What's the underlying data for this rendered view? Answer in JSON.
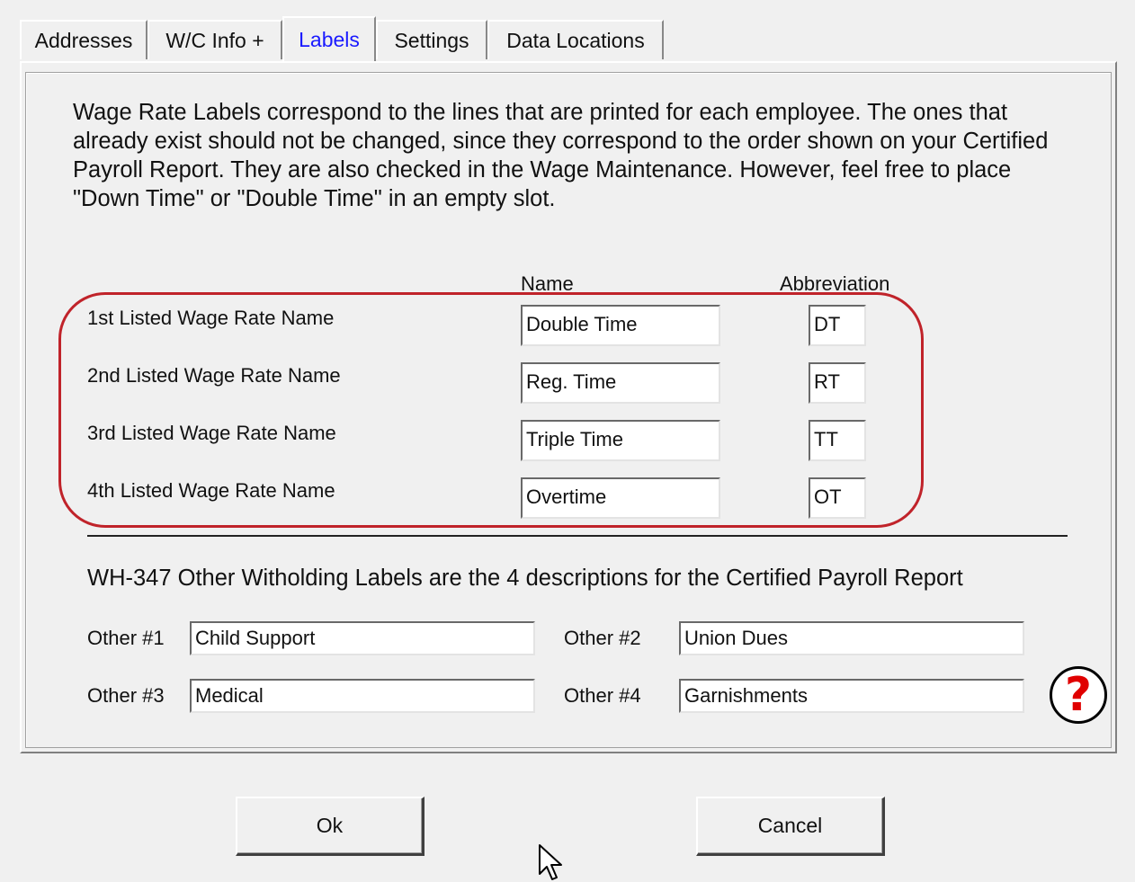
{
  "tabs": [
    {
      "label": "Addresses",
      "active": false
    },
    {
      "label": "W/C Info +",
      "active": false
    },
    {
      "label": "Labels",
      "active": true
    },
    {
      "label": "Settings",
      "active": false
    },
    {
      "label": "Data Locations",
      "active": false
    }
  ],
  "intro_text": "Wage Rate Labels correspond to the lines that are printed for each employee.  The ones that already exist should not be changed, since they correspond to the order shown on your Certified Payroll Report.  They are also checked in the Wage Maintenance.    However, feel free to place \"Down Time\" or \"Double Time\" in an empty slot.",
  "columns": {
    "name": "Name",
    "abbreviation": "Abbreviation"
  },
  "wage_rates": [
    {
      "label": "1st Listed Wage Rate Name",
      "name": "Double Time",
      "abbr": "DT"
    },
    {
      "label": "2nd Listed Wage Rate Name",
      "name": "Reg. Time",
      "abbr": "RT"
    },
    {
      "label": "3rd Listed Wage Rate Name",
      "name": "Triple Time",
      "abbr": "TT"
    },
    {
      "label": "4th Listed Wage Rate Name",
      "name": "Overtime",
      "abbr": "OT"
    }
  ],
  "other_heading": "WH-347 Other Witholding Labels are the 4 descriptions for the Certified Payroll Report",
  "others": [
    {
      "label": "Other #1",
      "value": "Child Support"
    },
    {
      "label": "Other #2",
      "value": "Union Dues"
    },
    {
      "label": "Other #3",
      "value": "Medical"
    },
    {
      "label": "Other #4",
      "value": "Garnishments"
    }
  ],
  "help_icon": "question-mark-icon",
  "buttons": {
    "ok": "Ok",
    "cancel": "Cancel"
  },
  "colors": {
    "highlight": "#c0232a",
    "active_tab": "#1a1aff",
    "help": "#e00000"
  }
}
